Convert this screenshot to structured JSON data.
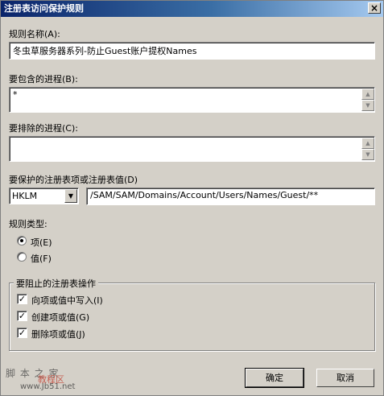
{
  "window": {
    "title": "注册表访问保护规则",
    "close_glyph": "×"
  },
  "rule_name": {
    "label": "规则名称(A):",
    "value": "冬虫草服务器系列-防止Guest账户提权Names"
  },
  "include_process": {
    "label": "要包含的进程(B):",
    "value": "*"
  },
  "exclude_process": {
    "label": "要排除的进程(C):",
    "value": ""
  },
  "registry": {
    "label": "要保护的注册表项或注册表值(D)",
    "hive": "HKLM",
    "path": "/SAM/SAM/Domains/Account/Users/Names/Guest/**"
  },
  "rule_type": {
    "label": "规则类型:",
    "options": [
      {
        "label": "项(E)",
        "selected": true
      },
      {
        "label": "值(F)",
        "selected": false
      }
    ]
  },
  "operations": {
    "title": "要阻止的注册表操作",
    "items": [
      {
        "label": "向项或值中写入(I)",
        "checked": true
      },
      {
        "label": "创建项或值(G)",
        "checked": true
      },
      {
        "label": "删除项或值(J)",
        "checked": true
      }
    ]
  },
  "buttons": {
    "ok": "确定",
    "cancel": "取消"
  },
  "watermark": {
    "line1": "脚 本 之 家",
    "line2": "教程区",
    "line3": "www.Jb51.net"
  }
}
